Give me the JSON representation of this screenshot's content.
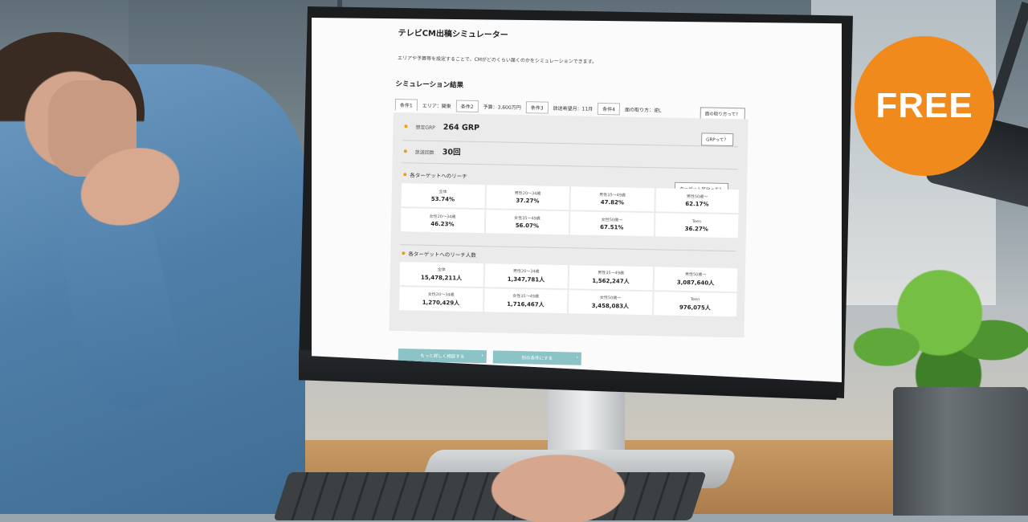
{
  "app": {
    "title": "テレビCM出稿シミュレーター",
    "description": "エリアや予算等を設定することで、CMがどのくらい届くのかをシミュレーションできます。",
    "section_title": "シミュレーション結果"
  },
  "conditions": [
    {
      "tab": "条件1",
      "value": "エリア：関東"
    },
    {
      "tab": "条件2",
      "value": "予算：3,600万円"
    },
    {
      "tab": "条件3",
      "value": "放送希望月：11月"
    },
    {
      "tab": "条件4",
      "value": "面の取り方：逆L"
    }
  ],
  "help": {
    "conditions": "面の取り方って？",
    "grp": "GRPって？",
    "target": "ターゲット区分って？"
  },
  "metrics": {
    "grp_label": "想定GRP",
    "grp_value": "264 GRP",
    "count_label": "放送回数",
    "count_value": "30回"
  },
  "reach": {
    "title": "各ターゲットへのリーチ",
    "cells": [
      {
        "label": "全体",
        "value": "53.74%"
      },
      {
        "label": "男性20〜34歳",
        "value": "37.27%"
      },
      {
        "label": "男性35〜49歳",
        "value": "47.82%"
      },
      {
        "label": "男性50歳〜",
        "value": "62.17%"
      },
      {
        "label": "女性20〜34歳",
        "value": "46.23%"
      },
      {
        "label": "女性35〜49歳",
        "value": "56.07%"
      },
      {
        "label": "女性50歳〜",
        "value": "67.51%"
      },
      {
        "label": "Teen",
        "value": "36.27%"
      }
    ]
  },
  "reach_people": {
    "title": "各ターゲットへのリーチ人数",
    "cells": [
      {
        "label": "全体",
        "value": "15,478,211人"
      },
      {
        "label": "男性20〜34歳",
        "value": "1,347,781人"
      },
      {
        "label": "男性35〜49歳",
        "value": "1,562,247人"
      },
      {
        "label": "男性50歳〜",
        "value": "3,087,640人"
      },
      {
        "label": "女性20〜34歳",
        "value": "1,270,429人"
      },
      {
        "label": "女性35〜49歳",
        "value": "1,716,467人"
      },
      {
        "label": "女性50歳〜",
        "value": "3,458,083人"
      },
      {
        "label": "Teen",
        "value": "976,075人"
      }
    ]
  },
  "actions": {
    "consult": "もっと詳しく相談する",
    "other": "別の条件にする"
  },
  "badge": {
    "text": "FREE",
    "color": "#f18a1c"
  },
  "colors": {
    "accent_dot": "#e8a21a",
    "action_button": "#8cc3c6"
  }
}
